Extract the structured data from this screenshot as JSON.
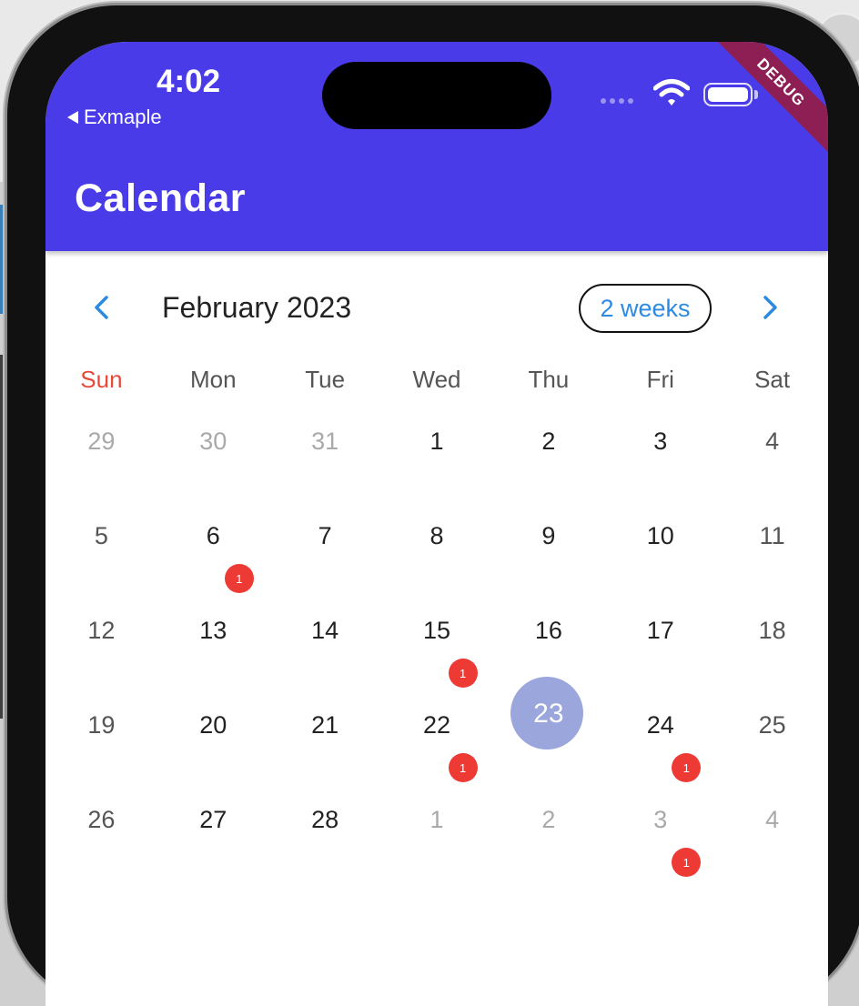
{
  "status_bar": {
    "time": "4:02",
    "back_label": "Exmaple",
    "debug_label": "DEBUG"
  },
  "app_bar": {
    "title": "Calendar"
  },
  "calendar": {
    "month_label": "February 2023",
    "format_label": "2 weeks",
    "weekdays": [
      "Sun",
      "Mon",
      "Tue",
      "Wed",
      "Thu",
      "Fri",
      "Sat"
    ],
    "weeks": [
      [
        {
          "day": "29",
          "muted": true
        },
        {
          "day": "30",
          "muted": true
        },
        {
          "day": "31",
          "muted": true
        },
        {
          "day": "1"
        },
        {
          "day": "2"
        },
        {
          "day": "3"
        },
        {
          "day": "4"
        }
      ],
      [
        {
          "day": "5"
        },
        {
          "day": "6",
          "events": "1"
        },
        {
          "day": "7"
        },
        {
          "day": "8"
        },
        {
          "day": "9"
        },
        {
          "day": "10"
        },
        {
          "day": "11"
        }
      ],
      [
        {
          "day": "12"
        },
        {
          "day": "13"
        },
        {
          "day": "14"
        },
        {
          "day": "15",
          "events": "1"
        },
        {
          "day": "16"
        },
        {
          "day": "17"
        },
        {
          "day": "18"
        }
      ],
      [
        {
          "day": "19"
        },
        {
          "day": "20"
        },
        {
          "day": "21"
        },
        {
          "day": "22",
          "events": "1"
        },
        {
          "day": "23",
          "today": true
        },
        {
          "day": "24",
          "events": "1"
        },
        {
          "day": "25"
        }
      ],
      [
        {
          "day": "26"
        },
        {
          "day": "27"
        },
        {
          "day": "28"
        },
        {
          "day": "1",
          "muted": true
        },
        {
          "day": "2",
          "muted": true
        },
        {
          "day": "3",
          "muted": true,
          "events": "1"
        },
        {
          "day": "4",
          "muted": true
        }
      ]
    ]
  },
  "colors": {
    "app_bar": "#4a3be8",
    "accent": "#2c8ae0",
    "today": "#9aa6dc",
    "badge": "#ee3a34",
    "sunday": "#e74a3b"
  },
  "icons": {
    "prev": "chevron-left-icon",
    "next": "chevron-right-icon",
    "wifi": "wifi-icon",
    "battery": "battery-icon"
  }
}
